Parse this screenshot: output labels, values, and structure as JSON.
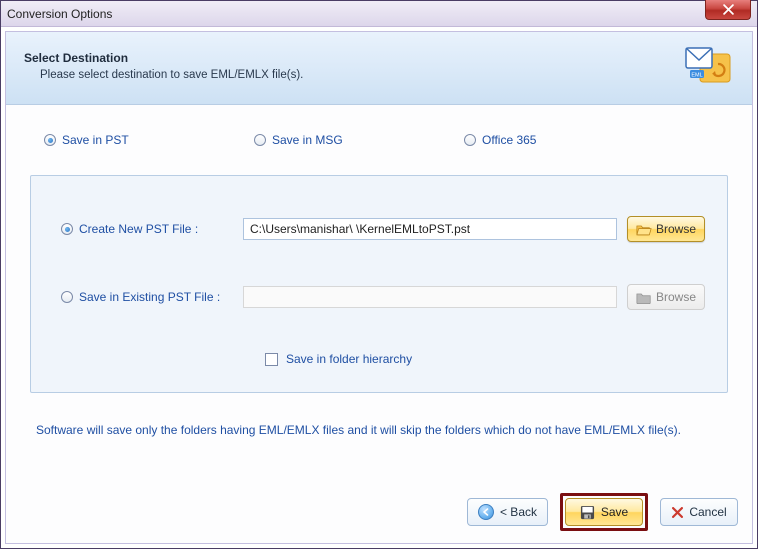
{
  "window_title": "Conversion Options",
  "header": {
    "title": "Select Destination",
    "subtitle": "Please select destination to save EML/EMLX file(s)."
  },
  "dest_radios": {
    "pst": "Save in PST",
    "msg": "Save in MSG",
    "o365": "Office 365"
  },
  "group": {
    "create_new_label": "Create New PST File :",
    "existing_label": "Save in Existing PST File :",
    "browse_label": "Browse",
    "new_path": "C:\\Users\\manishar\\         \\KernelEMLtoPST.pst",
    "existing_path": "",
    "hierarchy_label": "Save in folder hierarchy"
  },
  "note_text": "Software will save only the folders having EML/EMLX files and it will skip the folders which do not have EML/EMLX file(s).",
  "buttons": {
    "back": "< Back",
    "save": "Save",
    "cancel": "Cancel"
  }
}
